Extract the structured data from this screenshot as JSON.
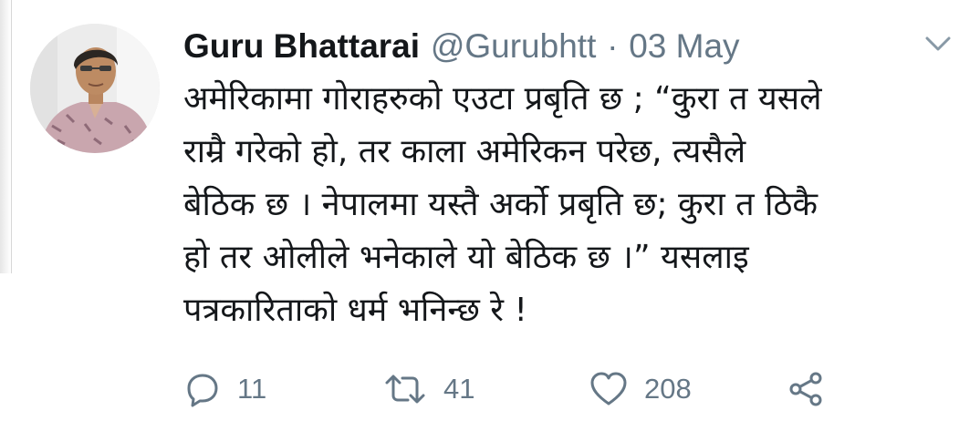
{
  "tweet": {
    "author_name": "Guru Bhattarai",
    "author_handle": "@Gurubhtt",
    "separator": "·",
    "date": "03 May",
    "text_lines": [
      "अमेरिकामा गोराहरुको एउटा प्रबृति छ ; “कुरा त यसले",
      "राम्रै गरेको हो, तर काला अमेरिकन परेछ, त्यसैले",
      "बेठिक छ । नेपालमा यस्तै अर्को प्रबृति छ; कुरा त ठिकै",
      "हो तर ओलीले भनेकाले यो बेठिक छ ।”  यसलाइ",
      "पत्रकारिताको धर्म भनिन्छ रे !"
    ],
    "replies": "11",
    "retweets": "41",
    "likes": "208"
  },
  "icons": {
    "reply": "reply-icon",
    "retweet": "retweet-icon",
    "like": "heart-icon",
    "share": "share-icon",
    "menu": "chevron-down-icon"
  },
  "colors": {
    "text_primary": "#14171a",
    "text_secondary": "#657786",
    "icon": "#657786"
  }
}
